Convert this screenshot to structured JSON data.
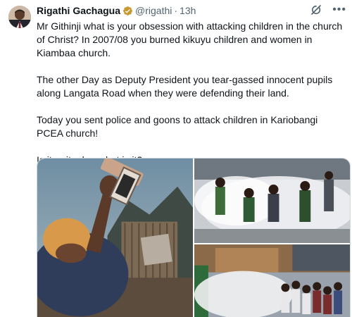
{
  "tweet": {
    "author_name": "Rigathi Gachagua",
    "handle": "@rigathi",
    "separator": "·",
    "time": "13h",
    "icons": {
      "avatar": "profile-photo",
      "verified": "verified-badge-icon",
      "grok": "grok-icon",
      "more": "more-icon"
    },
    "paragraphs": [
      "Mr Githinji what is your obsession with attacking children in the church of Christ? In 2007/08 you burned kikuyu children and women in Kiambaa church.",
      "The other Day as Deputy President you tear-gassed innocent pupils along Langata Road when they were defending their land.",
      "Today you sent police and goons to attack children in Kariobangi PCEA church!",
      "Is it a ritual or what is it?"
    ],
    "media": [
      {
        "name": "photo-woman-burned-church"
      },
      {
        "name": "photo-pupils-teargas"
      },
      {
        "name": "photo-church-teargas"
      }
    ],
    "colors": {
      "verified": "#c69a2f",
      "text": "#0f1419",
      "secondary": "#536471"
    }
  }
}
